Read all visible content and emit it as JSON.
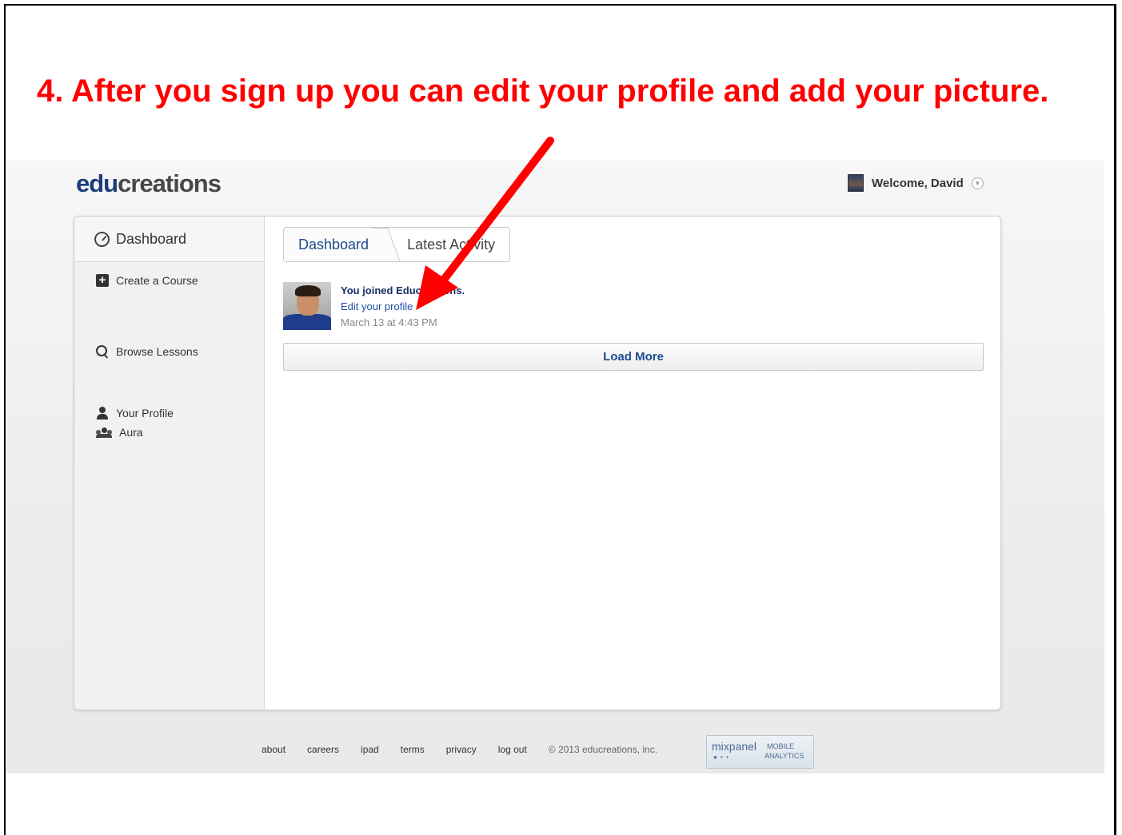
{
  "slide": {
    "title": "4. After you sign up you can edit your profile and add your picture."
  },
  "header": {
    "logo_edu": "edu",
    "logo_rest": "creations",
    "welcome_text": "Welcome, David"
  },
  "sidebar": {
    "dashboard_label": "Dashboard",
    "items": [
      {
        "label": "Create a Course"
      },
      {
        "label": "Browse Lessons"
      },
      {
        "label": "Your Profile"
      },
      {
        "label": "Aura"
      }
    ]
  },
  "breadcrumb": {
    "current": "Dashboard",
    "next": "Latest Activity"
  },
  "activity": {
    "headline": "You joined Educreations.",
    "link": "Edit your profile",
    "timestamp": "March 13 at 4:43 PM"
  },
  "load_more_label": "Load More",
  "footer": {
    "links": [
      "about",
      "careers",
      "ipad",
      "terms",
      "privacy",
      "log out"
    ],
    "copyright": "© 2013 educreations, inc.",
    "badge_brand": "mixpanel",
    "badge_mobile": "MOBILE",
    "badge_analytics": "ANALYTICS"
  },
  "colors": {
    "title": "#ff0000",
    "arrow": "#ff0000",
    "brand_blue": "#1c4a8c"
  }
}
